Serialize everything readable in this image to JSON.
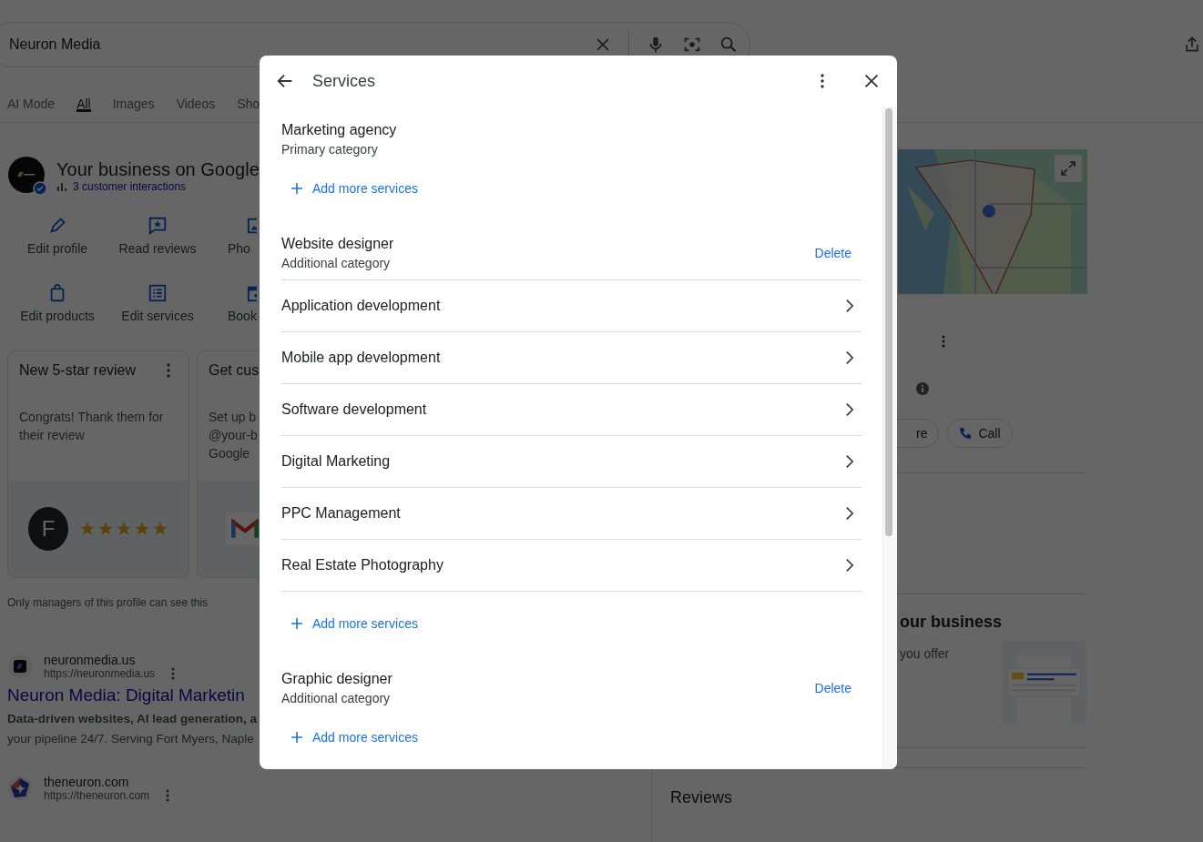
{
  "search": {
    "value": "Neuron Media"
  },
  "tabs": [
    {
      "label": "AI Mode",
      "selected": false
    },
    {
      "label": "All",
      "selected": true
    },
    {
      "label": "Images",
      "selected": false
    },
    {
      "label": "Videos",
      "selected": false
    },
    {
      "label": "Sho",
      "selected": false
    }
  ],
  "business": {
    "title": "Your business on Google",
    "interactions": "3 customer interactions",
    "actions": [
      {
        "label": "Edit profile",
        "kind": "pencil"
      },
      {
        "label": "Read reviews",
        "kind": "review"
      },
      {
        "label": "Pho"
      },
      {
        "label": "Edit products",
        "kind": "bag"
      },
      {
        "label": "Edit services",
        "kind": "list"
      },
      {
        "label": "Book",
        "kind": "calendar"
      }
    ]
  },
  "cards": [
    {
      "kind": "review",
      "title": "New 5-star review",
      "text": "Congrats! Thank them for their review",
      "avatar": "F",
      "stars": 5
    },
    {
      "kind": "email",
      "title": "Get cus",
      "lines": [
        "Set up b",
        "@your-b",
        "Google"
      ]
    }
  ],
  "managers_note": "Only managers of this profile can see this",
  "results": [
    {
      "site": "neuronmedia.us",
      "url": "https://neuronmedia.us",
      "title": "Neuron Media: Digital Marketin",
      "snippet": [
        {
          "text": "Data-driven websites, AI lead generation, a",
          "bold": true
        },
        {
          "text": "your pipeline 24/7. Serving Fort Myers, Naple",
          "bold": false
        }
      ]
    },
    {
      "site": "theneuron.com",
      "url": "https://theneuron.com"
    }
  ],
  "side": {
    "buttons": [
      "re",
      "Call"
    ],
    "section_title": "our business",
    "section_text": "you offer",
    "reviews_title": "Reviews"
  },
  "dialog": {
    "title": "Services",
    "categories": [
      {
        "name": "Marketing agency",
        "type": "Primary category",
        "add_label": "Add more services"
      },
      {
        "name": "Website designer",
        "type": "Additional category",
        "delete_label": "Delete",
        "services": [
          "Application development",
          "Mobile app development",
          "Software development",
          "Digital Marketing",
          "PPC Management",
          "Real Estate Photography"
        ],
        "add_label": "Add more services"
      },
      {
        "name": "Graphic designer",
        "type": "Additional category",
        "delete_label": "Delete",
        "add_label": "Add more services"
      }
    ]
  }
}
